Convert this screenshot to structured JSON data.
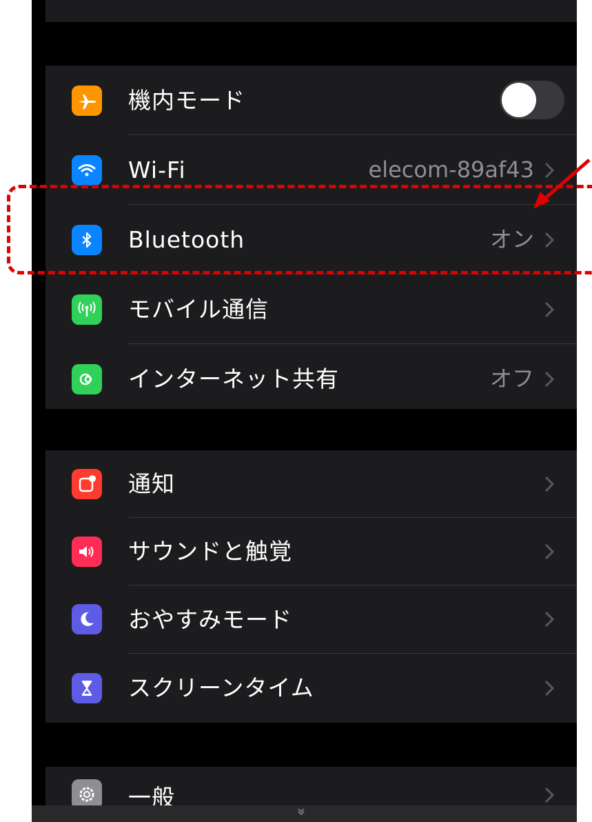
{
  "colors": {
    "airplane": "#ff9500",
    "wifi": "#0a84ff",
    "bluetooth": "#0a84ff",
    "cellular": "#30d158",
    "hotspot": "#30d158",
    "notifications": "#ff3b30",
    "sounds": "#ff2d55",
    "focus": "#5e5ce6",
    "screen_time": "#5e5ce6",
    "general": "#8e8e93",
    "annotation": "#e00000"
  },
  "group1": [
    {
      "label": "機内モード",
      "icon": "airplane-icon",
      "toggle": false
    },
    {
      "label": "Wi-Fi",
      "icon": "wifi-icon",
      "value": "elecom-89af43"
    },
    {
      "label": "Bluetooth",
      "icon": "bluetooth-icon",
      "value": "オン"
    },
    {
      "label": "モバイル通信",
      "icon": "antenna-icon",
      "value": ""
    },
    {
      "label": "インターネット共有",
      "icon": "link-icon",
      "value": "オフ"
    }
  ],
  "group2": [
    {
      "label": "通知",
      "icon": "notification-icon"
    },
    {
      "label": "サウンドと触覚",
      "icon": "speaker-icon"
    },
    {
      "label": "おやすみモード",
      "icon": "moon-icon"
    },
    {
      "label": "スクリーンタイム",
      "icon": "hourglass-icon"
    }
  ],
  "group3": [
    {
      "label": "一般",
      "icon": "gear-icon"
    }
  ]
}
